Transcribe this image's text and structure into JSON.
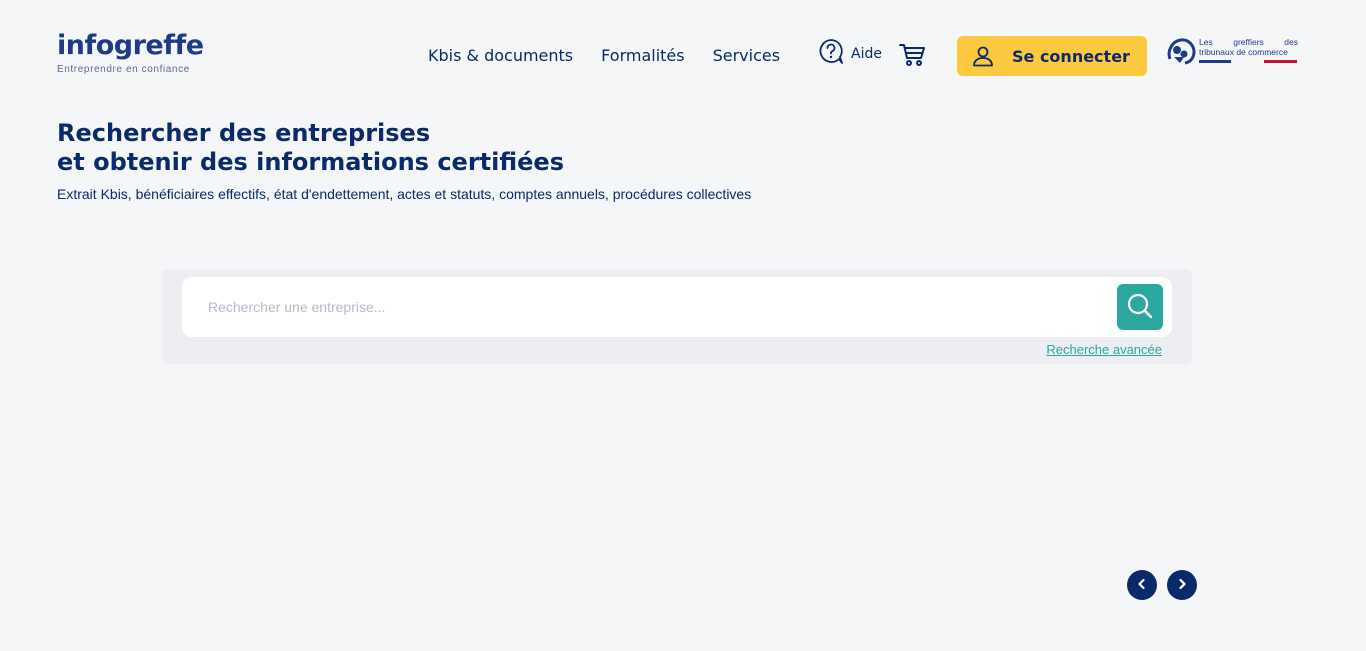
{
  "header": {
    "logo": {
      "name": "infogreffe",
      "tagline": "Entreprendre en confiance"
    },
    "nav": [
      {
        "label": "Kbis & documents"
      },
      {
        "label": "Formalités"
      },
      {
        "label": "Services"
      }
    ],
    "help": {
      "label": "Aide",
      "icon": "help-question-icon"
    },
    "cart": {
      "icon": "cart-icon"
    },
    "login": {
      "label": "Se connecter",
      "icon": "user-icon",
      "color": "#fcc93e"
    },
    "partner_logo": {
      "line1_left": "Les",
      "line1_mid": "greffiers",
      "line1_right": "des",
      "line2": "tribunaux de commerce"
    }
  },
  "hero": {
    "title_line1": "Rechercher des entreprises",
    "title_line2": "et obtenir des informations certifiées",
    "subtitle": "Extrait Kbis, bénéficiaires effectifs, état d'endettement, actes et statuts, comptes annuels, procédures collectives"
  },
  "search": {
    "placeholder": "Rechercher une entreprise...",
    "value": "",
    "button_icon": "search-icon",
    "advanced_label": "Recherche avancée",
    "accent": "#2ba7a0"
  },
  "carousel": {
    "prev_icon": "chevron-left-icon",
    "next_icon": "chevron-right-icon"
  },
  "colors": {
    "primary": "#0b2a6b",
    "background": "#f5f6f8"
  }
}
